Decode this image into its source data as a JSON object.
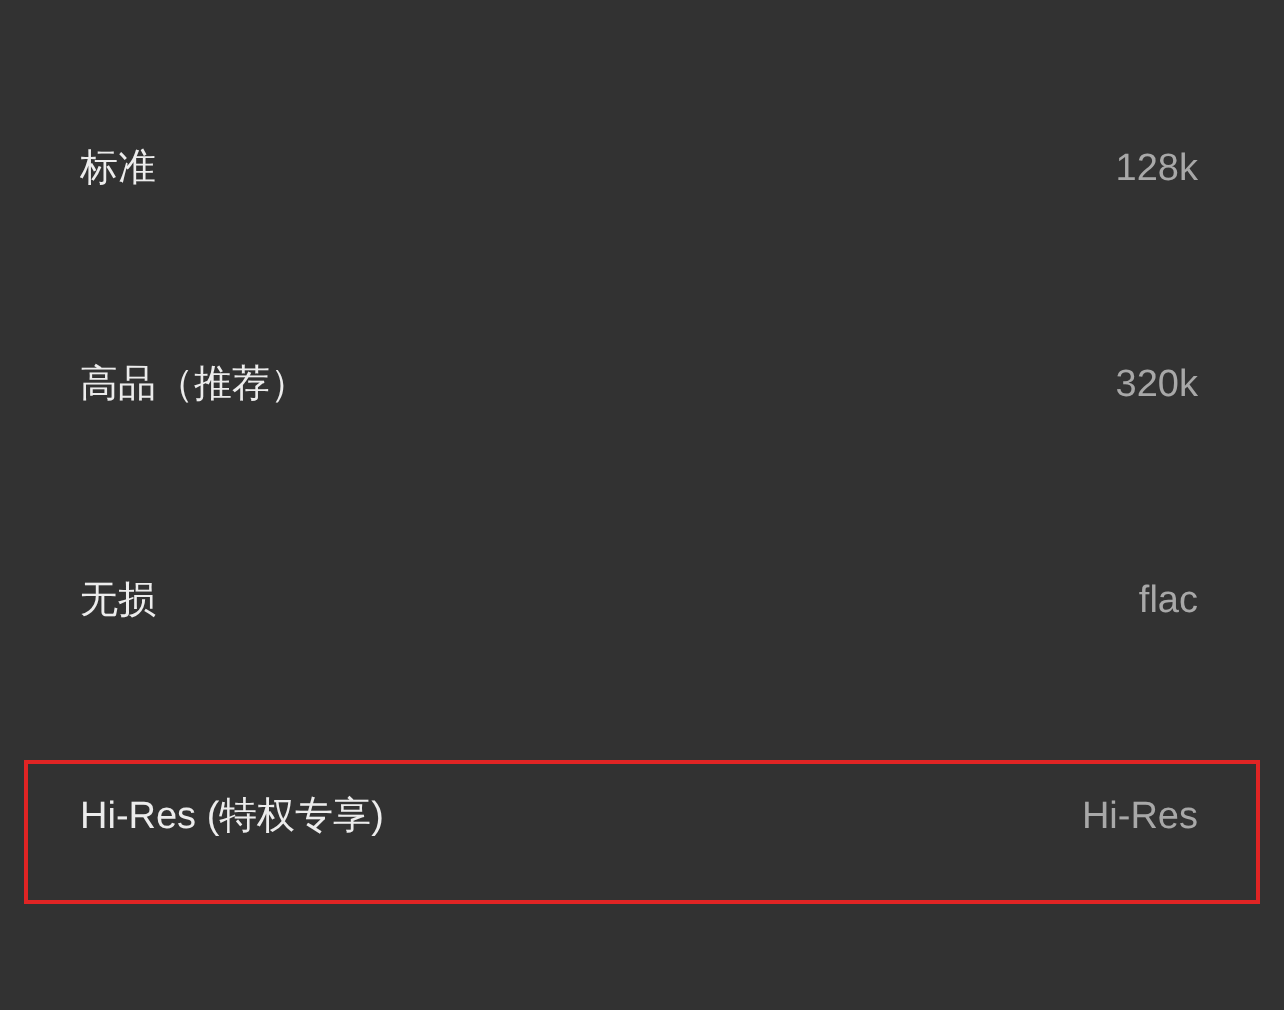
{
  "options": [
    {
      "label": "标准",
      "value": "128k",
      "highlighted": false
    },
    {
      "label": "高品（推荐）",
      "value": "320k",
      "highlighted": false
    },
    {
      "label": "无损",
      "value": "flac",
      "highlighted": false
    },
    {
      "label": "Hi-Res (特权专享)",
      "value": "Hi-Res",
      "highlighted": true
    }
  ]
}
